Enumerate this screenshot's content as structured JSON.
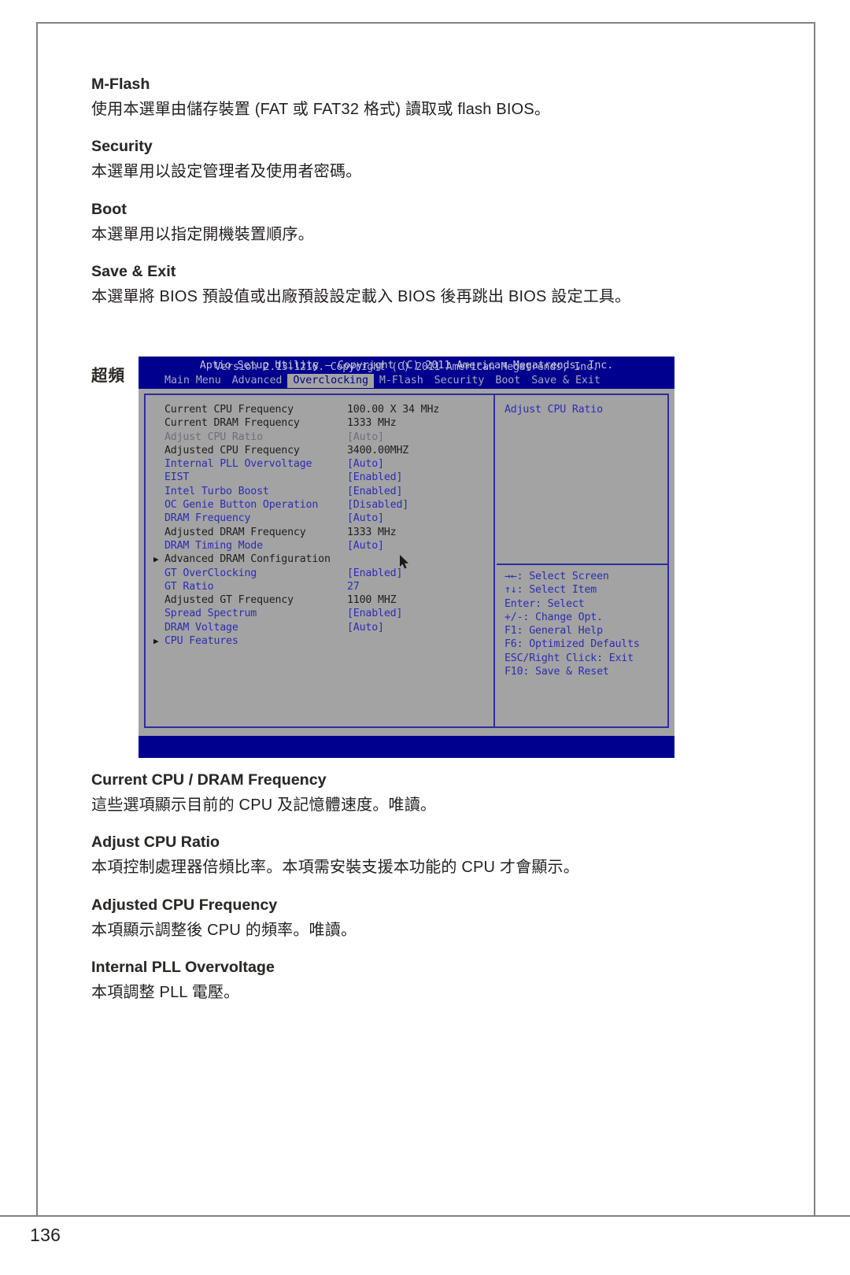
{
  "page": {
    "number": "136"
  },
  "upper_sections": [
    {
      "title": "M-Flash",
      "body": "使用本選單由儲存裝置 (FAT 或 FAT32 格式) 讀取或 flash BIOS。"
    },
    {
      "title": "Security",
      "body": "本選單用以設定管理者及使用者密碼。"
    },
    {
      "title": "Boot",
      "body": "本選單用以指定開機裝置順序。"
    },
    {
      "title": "Save & Exit",
      "body": "本選單將 BIOS 預設值或出廠預設設定載入 BIOS 後再跳出 BIOS 設定工具。"
    }
  ],
  "overclocking_heading": "超頻",
  "bios": {
    "title": "Aptio Setup Utility – Copyright (C) 2011 American Megatrends, Inc.",
    "menu": [
      {
        "label": "Main Menu",
        "active": false
      },
      {
        "label": "Advanced",
        "active": false
      },
      {
        "label": "Overclocking",
        "active": true
      },
      {
        "label": "M-Flash",
        "active": false
      },
      {
        "label": "Security",
        "active": false
      },
      {
        "label": "Boot",
        "active": false
      },
      {
        "label": "Save & Exit",
        "active": false
      }
    ],
    "settings": [
      {
        "label": "Current CPU Frequency",
        "value": "100.00 X 34 MHz",
        "color": "dark",
        "submenu": false
      },
      {
        "label": "Current DRAM Frequency",
        "value": "1333 MHz",
        "color": "dark",
        "submenu": false
      },
      {
        "label": "Adjust CPU Ratio",
        "value": "[Auto]",
        "color": "gray",
        "submenu": false
      },
      {
        "label": "Adjusted CPU Frequency",
        "value": "3400.00MHZ",
        "color": "dark",
        "submenu": false
      },
      {
        "label": "Internal PLL Overvoltage",
        "value": "[Auto]",
        "color": "blue",
        "submenu": false
      },
      {
        "label": "EIST",
        "value": "[Enabled]",
        "color": "blue",
        "submenu": false
      },
      {
        "label": "Intel Turbo Boost",
        "value": "[Enabled]",
        "color": "blue",
        "submenu": false
      },
      {
        "label": "OC Genie Button Operation",
        "value": "[Disabled]",
        "color": "blue",
        "submenu": false
      },
      {
        "label": "DRAM Frequency",
        "value": "[Auto]",
        "color": "blue",
        "submenu": false
      },
      {
        "label": "Adjusted DRAM Frequency",
        "value": "1333 MHz",
        "color": "dark",
        "submenu": false
      },
      {
        "label": "DRAM Timing Mode",
        "value": "[Auto]",
        "color": "blue",
        "submenu": false
      },
      {
        "label": "Advanced DRAM Configuration",
        "value": "",
        "color": "dark",
        "submenu": true
      },
      {
        "label": "GT OverClocking",
        "value": "[Enabled]",
        "color": "blue",
        "submenu": false
      },
      {
        "label": "GT Ratio",
        "value": "27",
        "color": "blue",
        "submenu": false
      },
      {
        "label": "Adjusted GT Frequency",
        "value": "1100 MHZ",
        "color": "dark",
        "submenu": false
      },
      {
        "label": "Spread Spectrum",
        "value": "[Enabled]",
        "color": "blue",
        "submenu": false
      },
      {
        "label": "DRAM Voltage",
        "value": "[Auto]",
        "color": "blue",
        "submenu": false
      },
      {
        "label": "CPU Features",
        "value": "",
        "color": "blue",
        "submenu": true
      }
    ],
    "help_title": "Adjust CPU Ratio",
    "keys": [
      "→←: Select Screen",
      "↑↓: Select Item",
      "Enter: Select",
      "+/-: Change Opt.",
      "F1: General Help",
      "F6: Optimized Defaults",
      "ESC/Right Click: Exit",
      "F10: Save & Reset"
    ],
    "footer": "Version 2.13.1216. Copyright (C) 2011 American Megatrends, Inc.",
    "colors": {
      "screen_bg": "#a3a3a3",
      "bar_blue": "#00008f",
      "border_blue": "#2d2d9e",
      "text_blue": "#2d2db4"
    }
  },
  "lower_sections": [
    {
      "title": "Current CPU / DRAM Frequency",
      "body": "這些選項顯示目前的 CPU 及記憶體速度。唯讀。"
    },
    {
      "title": "Adjust CPU Ratio",
      "body": "本項控制處理器倍頻比率。本項需安裝支援本功能的 CPU 才會顯示。"
    },
    {
      "title": "Adjusted CPU Frequency",
      "body": "本項顯示調整後 CPU 的頻率。唯讀。"
    },
    {
      "title": "Internal PLL Overvoltage",
      "body": "本項調整 PLL 電壓。"
    }
  ]
}
